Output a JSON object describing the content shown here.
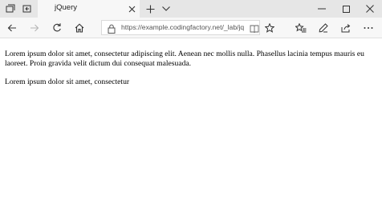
{
  "window": {
    "colors": {
      "titlebar_bg": "#e6e6e6",
      "active_tab_bg": "#f7f7f7",
      "toolbar_bg": "#f7f7f7",
      "icon": "#333333",
      "disabled_icon": "#b5b5b5"
    }
  },
  "titlebar": {
    "left_icons": [
      "tab-preview-icon",
      "set-aside-tabs-icon"
    ],
    "tab": {
      "title": "jQuery",
      "close_icon": "close-icon"
    },
    "new_tab_icon": "plus-icon",
    "tab_list_icon": "chevron-down-icon",
    "window_controls": [
      "minimize-icon",
      "maximize-icon",
      "close-icon"
    ]
  },
  "navbar": {
    "back_icon": "back-arrow-icon",
    "forward_icon": "forward-arrow-icon",
    "refresh_icon": "refresh-icon",
    "home_icon": "home-icon",
    "address": {
      "url": "https://example.codingfactory.net/_lab/jq",
      "lock_icon": "lock-icon",
      "reading_view_icon": "book-icon",
      "favorite_icon": "star-icon"
    },
    "right_icons": [
      "favorites-hub-icon",
      "pen-icon",
      "share-icon",
      "more-icon"
    ]
  },
  "page": {
    "paragraphs": [
      "Lorem ipsum dolor sit amet, consectetur adipiscing elit. Aenean nec mollis nulla. Phasellus lacinia tempus mauris eu laoreet. Proin gravida velit dictum dui consequat malesuada.",
      "Lorem ipsum dolor sit amet, consectetur"
    ]
  }
}
